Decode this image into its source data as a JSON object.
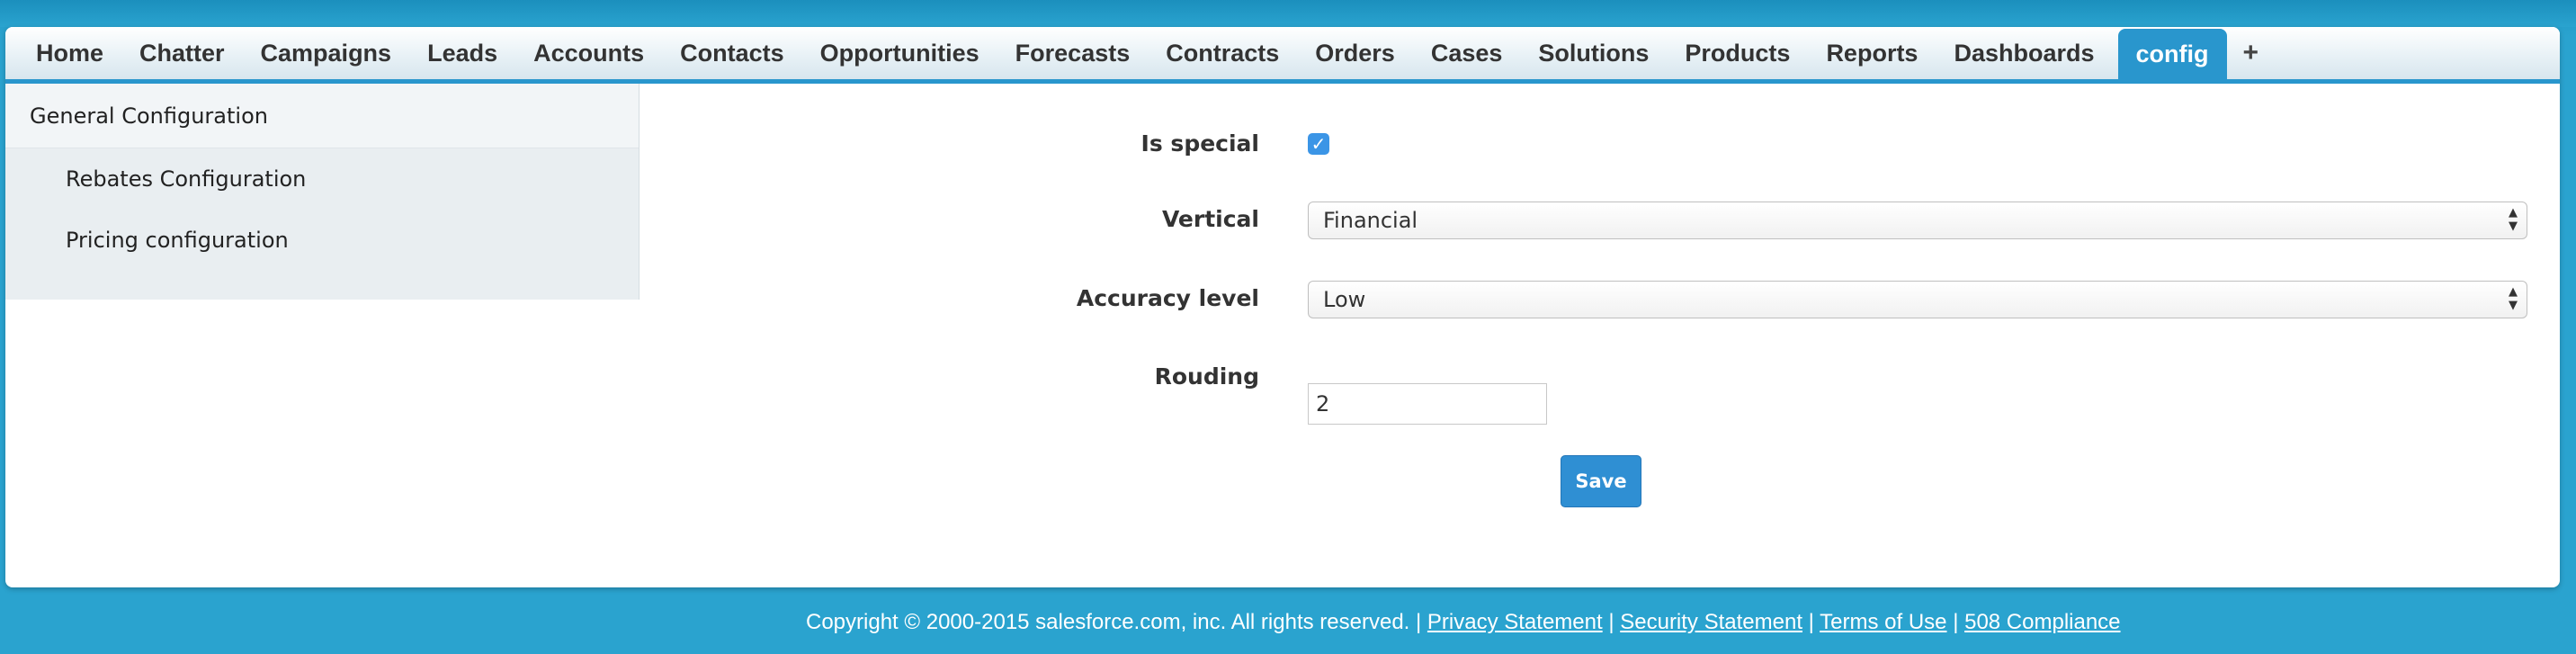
{
  "tabs": [
    "Home",
    "Chatter",
    "Campaigns",
    "Leads",
    "Accounts",
    "Contacts",
    "Opportunities",
    "Forecasts",
    "Contracts",
    "Orders",
    "Cases",
    "Solutions",
    "Products",
    "Reports",
    "Dashboards"
  ],
  "active_tab": "config",
  "plus_tab": "+",
  "sidebar": {
    "top": "General Configuration",
    "items": [
      "Rebates Configuration",
      "Pricing configuration"
    ]
  },
  "form": {
    "is_special_label": "Is special",
    "is_special_checked": true,
    "check_glyph": "✓",
    "vertical_label": "Vertical",
    "vertical_value": "Financial",
    "accuracy_label": "Accuracy level",
    "accuracy_value": "Low",
    "rounding_label": "Rouding",
    "rounding_value": "2",
    "save_label": "Save"
  },
  "footer": {
    "copyright": "Copyright © 2000-2015 salesforce.com, inc. All rights reserved. |",
    "links": [
      "Privacy Statement",
      "Security Statement",
      "Terms of Use",
      "508 Compliance"
    ],
    "sep": "|"
  },
  "colors": {
    "accent": "#2996cd",
    "background": "#2aa3cf",
    "button": "#2f8fd3"
  }
}
